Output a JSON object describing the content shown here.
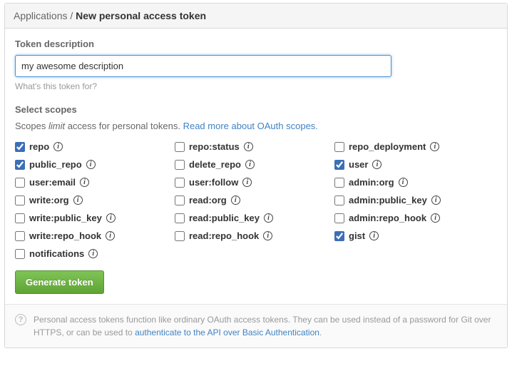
{
  "header": {
    "breadcrumb_parent": "Applications",
    "breadcrumb_sep": " / ",
    "breadcrumb_current": "New personal access token"
  },
  "description": {
    "label": "Token description",
    "value": "my awesome description",
    "hint": "What's this token for?"
  },
  "scopes": {
    "label": "Select scopes",
    "intro_a": "Scopes ",
    "intro_em": "limit",
    "intro_b": " access for personal tokens. ",
    "intro_link": "Read more about OAuth scopes.",
    "items": [
      {
        "name": "repo",
        "checked": true
      },
      {
        "name": "repo:status",
        "checked": false
      },
      {
        "name": "repo_deployment",
        "checked": false
      },
      {
        "name": "public_repo",
        "checked": true
      },
      {
        "name": "delete_repo",
        "checked": false
      },
      {
        "name": "user",
        "checked": true
      },
      {
        "name": "user:email",
        "checked": false
      },
      {
        "name": "user:follow",
        "checked": false
      },
      {
        "name": "admin:org",
        "checked": false
      },
      {
        "name": "write:org",
        "checked": false
      },
      {
        "name": "read:org",
        "checked": false
      },
      {
        "name": "admin:public_key",
        "checked": false
      },
      {
        "name": "write:public_key",
        "checked": false
      },
      {
        "name": "read:public_key",
        "checked": false
      },
      {
        "name": "admin:repo_hook",
        "checked": false
      },
      {
        "name": "write:repo_hook",
        "checked": false
      },
      {
        "name": "read:repo_hook",
        "checked": false
      },
      {
        "name": "gist",
        "checked": true
      },
      {
        "name": "notifications",
        "checked": false
      }
    ]
  },
  "button": {
    "generate": "Generate token"
  },
  "footer": {
    "text_a": "Personal access tokens function like ordinary OAuth access tokens. They can be used instead of a password for Git over HTTPS, or can be used to ",
    "link": "authenticate to the API over Basic Authentication",
    "text_b": "."
  }
}
